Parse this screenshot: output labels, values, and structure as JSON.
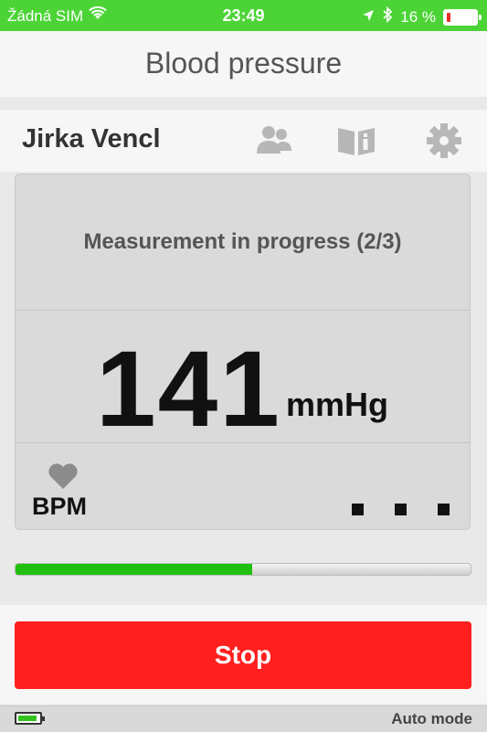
{
  "status_bar": {
    "carrier": "Žádná SIM",
    "time": "23:49",
    "battery_percent": "16 %",
    "battery_level": 0.16,
    "icons": [
      "wifi-icon",
      "location-icon",
      "bluetooth-icon",
      "battery-icon"
    ]
  },
  "header": {
    "title": "Blood pressure"
  },
  "user": {
    "name": "Jirka Vencl"
  },
  "measurement": {
    "status": "Measurement in progress (2/3)",
    "value": "141",
    "unit": "mmHg",
    "bpm_label": "BPM"
  },
  "progress": {
    "level": 0.52
  },
  "actions": {
    "stop_label": "Stop"
  },
  "footer": {
    "mode": "Auto mode"
  },
  "colors": {
    "status_green": "#4cd436",
    "stop_red": "#ff1f1f",
    "progress_green": "#22c00e"
  }
}
